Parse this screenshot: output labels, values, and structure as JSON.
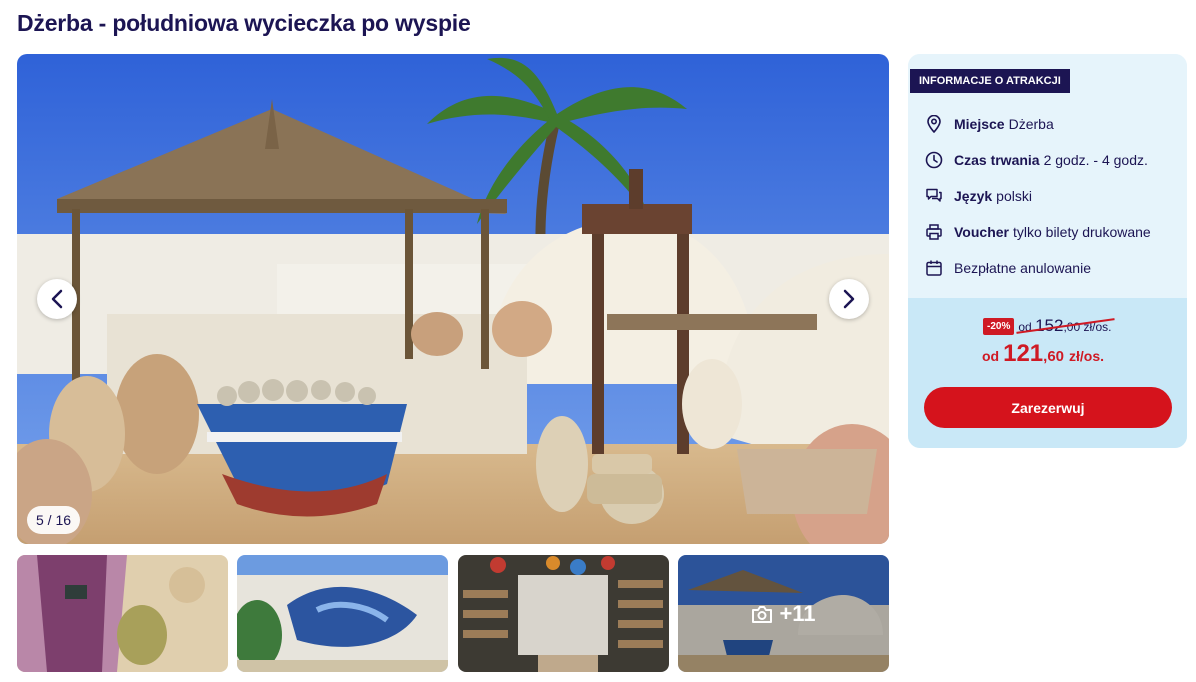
{
  "page": {
    "title": "Dżerba - południowa wycieczka po wyspie"
  },
  "gallery": {
    "counter": "5 / 16",
    "more_label": "+11",
    "icons": {
      "prev": "chevron-left-icon",
      "next": "chevron-right-icon",
      "more": "camera-icon"
    }
  },
  "info": {
    "badge": "INFORMACJE O ATRAKCJI",
    "rows": [
      {
        "icon": "map-pin-icon",
        "label": "Miejsce",
        "value": "Dżerba"
      },
      {
        "icon": "clock-icon",
        "label": "Czas trwania",
        "value": "2 godz. - 4 godz."
      },
      {
        "icon": "chat-icon",
        "label": "Język",
        "value": "polski"
      },
      {
        "icon": "printer-icon",
        "label": "Voucher",
        "value": "tylko bilety drukowane"
      },
      {
        "icon": "calendar-icon",
        "label": "",
        "value": "Bezpłatne anulowanie"
      }
    ]
  },
  "price": {
    "discount": "-20%",
    "old_prefix": "od",
    "old_int": "152",
    "old_dec": ",00",
    "old_unit": "zł/os.",
    "new_prefix": "od",
    "new_int": "121",
    "new_dec": ",60",
    "new_unit": "zł/os.",
    "accent": "#d5131c"
  },
  "actions": {
    "book_label": "Zarezerwuj"
  },
  "colors": {
    "navy": "#1c1553",
    "card_bg": "#e6f4fb",
    "price_bg": "#c9e8f7"
  }
}
